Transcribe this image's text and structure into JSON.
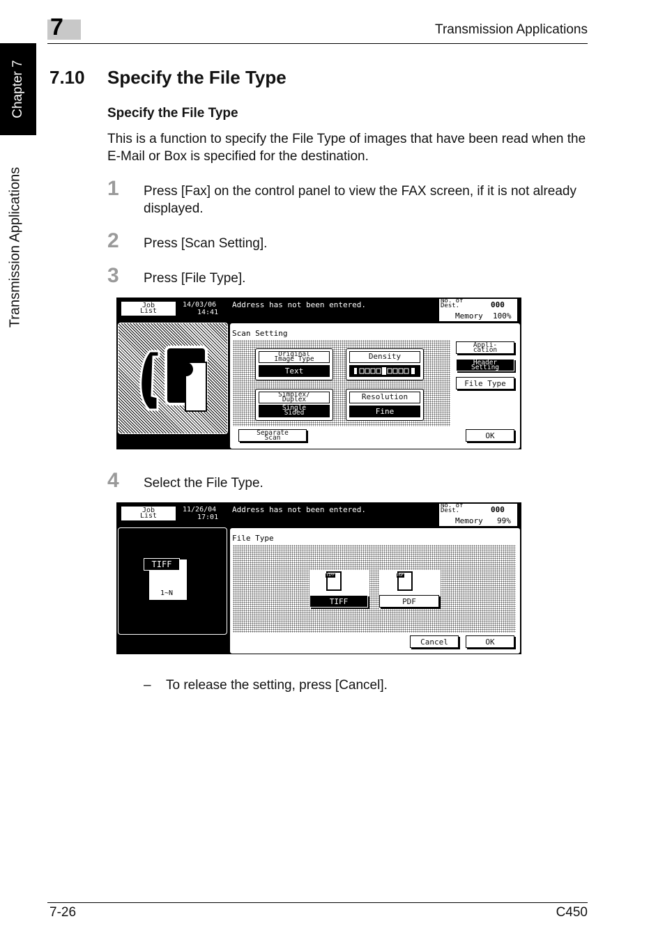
{
  "header": {
    "chapter_number": "7",
    "running_title": "Transmission Applications"
  },
  "side_tab": {
    "chapter_label": "Chapter 7",
    "section_label": "Transmission Applications"
  },
  "section": {
    "number": "7.10",
    "title": "Specify the File Type",
    "subheading": "Specify the File Type",
    "intro": "This is a function to specify the File Type of images that have been read when the E-Mail or Box is specified for the destination."
  },
  "steps": [
    {
      "num": "1",
      "text": "Press [Fax] on the control panel to view the FAX screen, if it is not already displayed."
    },
    {
      "num": "2",
      "text": "Press [Scan Setting]."
    },
    {
      "num": "3",
      "text": "Press [File Type]."
    },
    {
      "num": "4",
      "text": "Select the File Type."
    }
  ],
  "note": {
    "dash": "–",
    "text": "To release the setting, press [Cancel]."
  },
  "footer": {
    "page": "7-26",
    "model": "C450"
  },
  "screen1": {
    "job_list": "Job\nList",
    "date": "14/03/06",
    "time": "14:41",
    "message": "Address has not been entered.",
    "no_of_dest_label": "No. of\nDest.",
    "no_of_dest_value": "000",
    "memory_label": "Memory",
    "memory_value": "100%",
    "panel_title": "Scan Setting",
    "original_image_type_label": "Original\nImage Type",
    "original_image_type_value": "Text",
    "density_label": "Density",
    "simplex_duplex_label": "Simplex/\nDuplex",
    "simplex_duplex_value": "Single\nSided",
    "resolution_label": "Resolution",
    "resolution_value": "Fine",
    "application_button": "Appli-\ncation",
    "header_setting_button": "Header\nSetting",
    "file_type_button": "File Type",
    "separate_scan_button": "Separate\nScan",
    "ok_button": "OK"
  },
  "screen2": {
    "job_list": "Job\nList",
    "date": "11/26/04",
    "time": "17:01",
    "message": "Address has not been entered.",
    "no_of_dest_label": "No. of\nDest.",
    "no_of_dest_value": "000",
    "memory_label": "Memory",
    "memory_value": "99%",
    "panel_title": "File Type",
    "preview_label": "TIFF",
    "preview_pages": "1~N",
    "tiff_button": "TIFF",
    "tiff_icon_label": "TIFF",
    "pdf_button": "PDF",
    "pdf_icon_label": "PDF",
    "cancel_button": "Cancel",
    "ok_button": "OK"
  }
}
